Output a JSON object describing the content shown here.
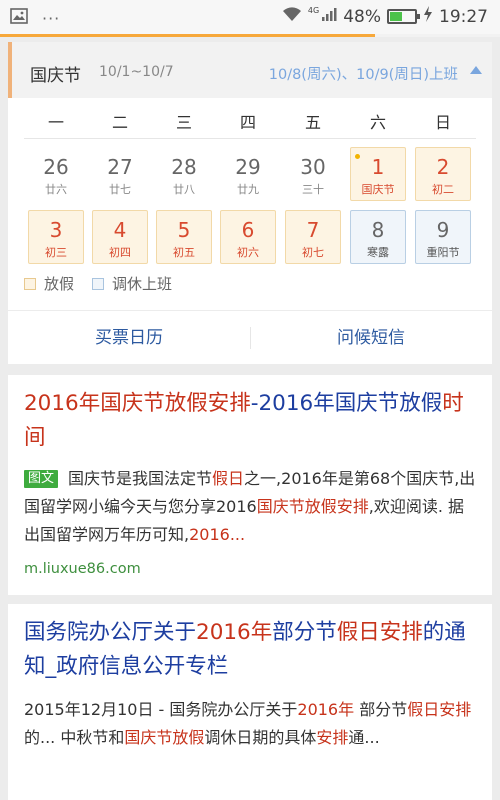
{
  "status_bar": {
    "battery": "48%",
    "battery_level": 0.48,
    "time": "19:27",
    "network": "4G"
  },
  "page_progress": 0.75,
  "calendar": {
    "title": "国庆节",
    "range": "10/1~10/7",
    "work_days_note": "10/8(周六)、10/9(周日)上班",
    "weekdays": [
      "一",
      "二",
      "三",
      "四",
      "五",
      "六",
      "日"
    ],
    "rows": [
      [
        {
          "num": "26",
          "lunar": "廿六",
          "kind": "plain"
        },
        {
          "num": "27",
          "lunar": "廿七",
          "kind": "plain"
        },
        {
          "num": "28",
          "lunar": "廿八",
          "kind": "plain"
        },
        {
          "num": "29",
          "lunar": "廿九",
          "kind": "plain"
        },
        {
          "num": "30",
          "lunar": "三十",
          "kind": "plain"
        },
        {
          "num": "1",
          "lunar": "国庆节",
          "kind": "holiday",
          "today": true
        },
        {
          "num": "2",
          "lunar": "初二",
          "kind": "holiday"
        }
      ],
      [
        {
          "num": "3",
          "lunar": "初三",
          "kind": "holiday"
        },
        {
          "num": "4",
          "lunar": "初四",
          "kind": "holiday"
        },
        {
          "num": "5",
          "lunar": "初五",
          "kind": "holiday"
        },
        {
          "num": "6",
          "lunar": "初六",
          "kind": "holiday"
        },
        {
          "num": "7",
          "lunar": "初七",
          "kind": "holiday"
        },
        {
          "num": "8",
          "lunar": "寒露",
          "kind": "work"
        },
        {
          "num": "9",
          "lunar": "重阳节",
          "kind": "work"
        }
      ]
    ],
    "legend_holiday": "放假",
    "legend_work": "调休上班",
    "action_tickets": "买票日历",
    "action_greetings": "问候短信"
  },
  "results": [
    {
      "title_parts": [
        {
          "text": "2016年国庆节放假安排",
          "hl": true
        },
        {
          "text": "-2016年国庆节放假",
          "hl": false
        },
        {
          "text": "时间",
          "hl": true
        }
      ],
      "badge": "图文",
      "snippet_parts": [
        {
          "text": "国庆节是我国法定节",
          "hl": false
        },
        {
          "text": "假日",
          "hl": true
        },
        {
          "text": "之一,2016年是第68个国庆节,出国留学网小编今天与您分享2016",
          "hl": false
        },
        {
          "text": "国庆节放假安排",
          "hl": true
        },
        {
          "text": ",欢迎阅读. 据出国留学网万年历可知,",
          "hl": false
        },
        {
          "text": "2016...",
          "hl": true
        }
      ],
      "url": "m.liuxue86.com"
    },
    {
      "title_parts": [
        {
          "text": "国务院办公厅关于",
          "hl": false
        },
        {
          "text": "2016年",
          "hl": true
        },
        {
          "text": "部分节",
          "hl": false
        },
        {
          "text": "假日安排",
          "hl": true
        },
        {
          "text": "的通知_政府信息公开专栏",
          "hl": false
        }
      ],
      "snippet_parts": [
        {
          "text": "2015年12月10日 - 国务院办公厅关于",
          "hl": false
        },
        {
          "text": "2016年",
          "hl": true
        },
        {
          "text": " 部分节",
          "hl": false
        },
        {
          "text": "假日安排",
          "hl": true
        },
        {
          "text": "的... 中秋节和",
          "hl": false
        },
        {
          "text": "国庆节放假",
          "hl": true
        },
        {
          "text": "调休日期的具体",
          "hl": false
        },
        {
          "text": "安排",
          "hl": true
        },
        {
          "text": "通...",
          "hl": false
        }
      ]
    }
  ]
}
